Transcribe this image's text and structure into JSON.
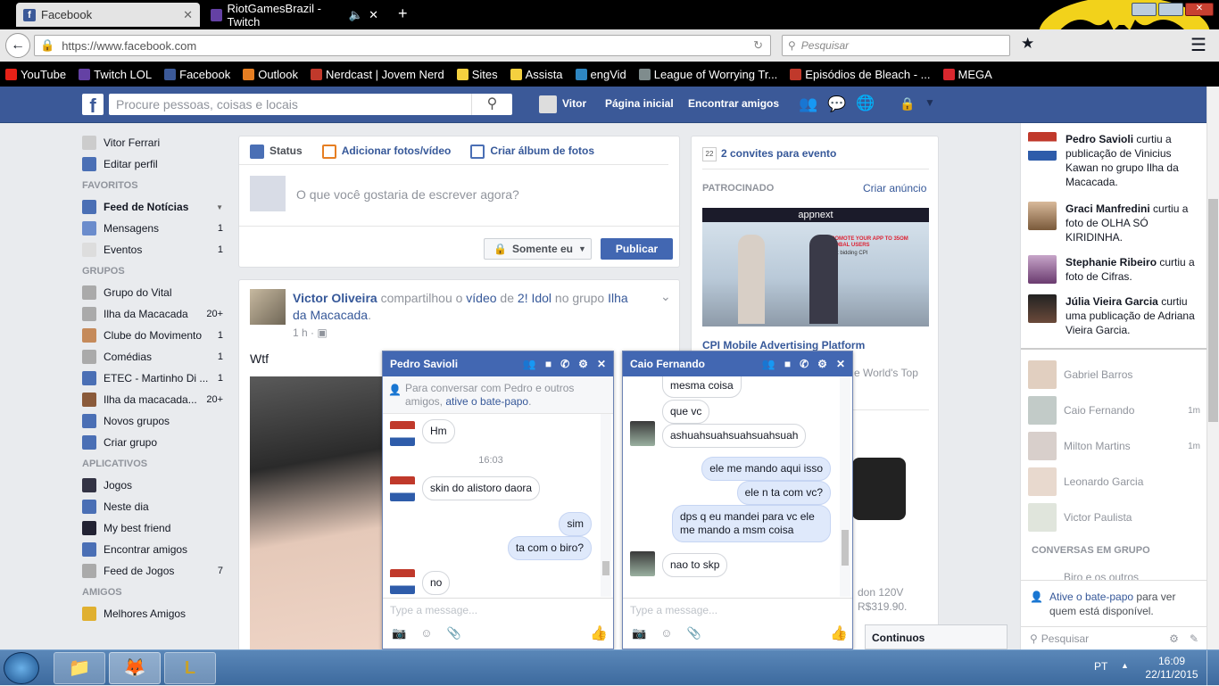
{
  "browser": {
    "tabs": [
      {
        "label": "Facebook",
        "icon": "facebook-icon"
      },
      {
        "label": "RiotGamesBrazil - Twitch",
        "icon": "twitch-icon"
      }
    ],
    "url": "https://www.facebook.com",
    "search_placeholder": "Pesquisar",
    "bookmarks": [
      "YouTube",
      "Twitch LOL",
      "Facebook",
      "Outlook",
      "Nerdcast | Jovem Nerd",
      "Sites",
      "Assista",
      "engVid",
      "League of Worrying Tr...",
      "Episódios de Bleach - ...",
      "MEGA"
    ],
    "bookmark_colors": [
      "#e62117",
      "#6441a4",
      "#3b5998",
      "#e67e22",
      "#c0392b",
      "#f4d03f",
      "#f4d03f",
      "#2e86c1",
      "#7f8c8d",
      "#c0392b",
      "#d9272e"
    ]
  },
  "fb": {
    "search_placeholder": "Procure pessoas, coisas e locais",
    "user": "Vitor",
    "nav": [
      "Página inicial",
      "Encontrar amigos"
    ],
    "left": {
      "profile_name": "Vitor Ferrari",
      "edit_profile": "Editar perfil",
      "favorites_header": "FAVORITOS",
      "favorites": [
        {
          "label": "Feed de Notícias",
          "count": ""
        },
        {
          "label": "Mensagens",
          "count": "1"
        },
        {
          "label": "Eventos",
          "count": "1"
        }
      ],
      "groups_header": "GRUPOS",
      "groups": [
        {
          "label": "Grupo do Vital",
          "count": ""
        },
        {
          "label": "Ilha da Macacada",
          "count": "20+"
        },
        {
          "label": "Clube do Movimento",
          "count": "1"
        },
        {
          "label": "Comédias",
          "count": "1"
        },
        {
          "label": "ETEC - Martinho Di ...",
          "count": "1"
        },
        {
          "label": "Ilha da macacada...",
          "count": "20+"
        },
        {
          "label": "Novos grupos",
          "count": ""
        },
        {
          "label": "Criar grupo",
          "count": ""
        }
      ],
      "apps_header": "APLICATIVOS",
      "apps": [
        {
          "label": "Jogos",
          "count": ""
        },
        {
          "label": "Neste dia",
          "count": ""
        },
        {
          "label": "My best friend",
          "count": ""
        },
        {
          "label": "Encontrar amigos",
          "count": ""
        },
        {
          "label": "Feed de Jogos",
          "count": "7"
        }
      ],
      "friends_header": "AMIGOS",
      "friends": [
        {
          "label": "Melhores Amigos",
          "count": ""
        }
      ]
    },
    "composer": {
      "tabs": [
        "Status",
        "Adicionar fotos/vídeo",
        "Criar álbum de fotos"
      ],
      "placeholder": "O que você gostaria de escrever agora?",
      "privacy": "Somente eu",
      "publish": "Publicar"
    },
    "post": {
      "author": "Victor Oliveira",
      "t1": " compartilhou o ",
      "video": "vídeo",
      "t2": " de ",
      "page": "2! Idol",
      "t3": " no grupo ",
      "group_a": "Ilha",
      "group_b": "da Macacada",
      "t4": ".",
      "time": "1 h",
      "text": "Wtf"
    },
    "right": {
      "events": "2 convites para evento",
      "event_day": "22",
      "sponsored": "PATROCINADO",
      "create_ad": "Criar anúncio",
      "ad_brand": "appnext",
      "ad_promo": "PROMOTE YOUR APP TO 35OM GLOBAL USERS",
      "ad_sub": "Start bidding CPI",
      "ad_title": "CPI Mobile Advertising Platform",
      "ad_desc_tail": "e World's Top",
      "ad2_desc_a": "don 120V",
      "ad2_desc_b": "R$319.90."
    },
    "ticker": [
      {
        "name": "Pedro Savioli",
        "text": " curtiu a publicação de Vinicius Kawan no grupo Ilha da Macacada."
      },
      {
        "name": "Graci Manfredini",
        "text": " curtiu a foto de OLHA SÓ KIRIDINHA."
      },
      {
        "name": "Stephanie Ribeiro",
        "text": " curtiu a foto de Cifras."
      },
      {
        "name": "Júlia Vieira Garcia",
        "text": " curtiu uma publicação de Adriana Vieira Garcia."
      }
    ],
    "online": [
      {
        "name": "Gabriel Barros",
        "time": ""
      },
      {
        "name": "Caio Fernando",
        "time": "1m"
      },
      {
        "name": "Milton Martins",
        "time": "1m"
      },
      {
        "name": "Leonardo Garcia",
        "time": ""
      },
      {
        "name": "Victor Paulista",
        "time": ""
      }
    ],
    "group_convos_header": "CONVERSAS EM GRUPO",
    "group_convo_partial": "Biro e os outros",
    "activate_chat": "Ative o bate-papo",
    "activate_chat_tail": " para ver quem está disponível.",
    "sidebar_search": "Pesquisar",
    "continue_btn": "Continuos"
  },
  "chat1": {
    "title": "Pedro Savioli",
    "notice_a": "Para conversar com Pedro e outros amigos, ",
    "notice_link": "ative o bate-papo",
    "notice_b": ".",
    "messages": [
      "Hm",
      "16:03",
      "skin do alistoro daora",
      "sim",
      "ta com o biro?",
      "no"
    ],
    "input_placeholder": "Type a message..."
  },
  "chat2": {
    "title": "Caio Fernando",
    "messages": [
      "mesma coisa",
      "que vc",
      "ashuahsuahsuahsuahsuah",
      "ele me mando aqui isso",
      "ele n ta com vc?",
      "dps q eu mandei para vc ele me mando a msm coisa",
      "nao to skp"
    ],
    "input_placeholder": "Type a message..."
  },
  "taskbar": {
    "lang": "PT",
    "time": "16:09",
    "date": "22/11/2015"
  }
}
